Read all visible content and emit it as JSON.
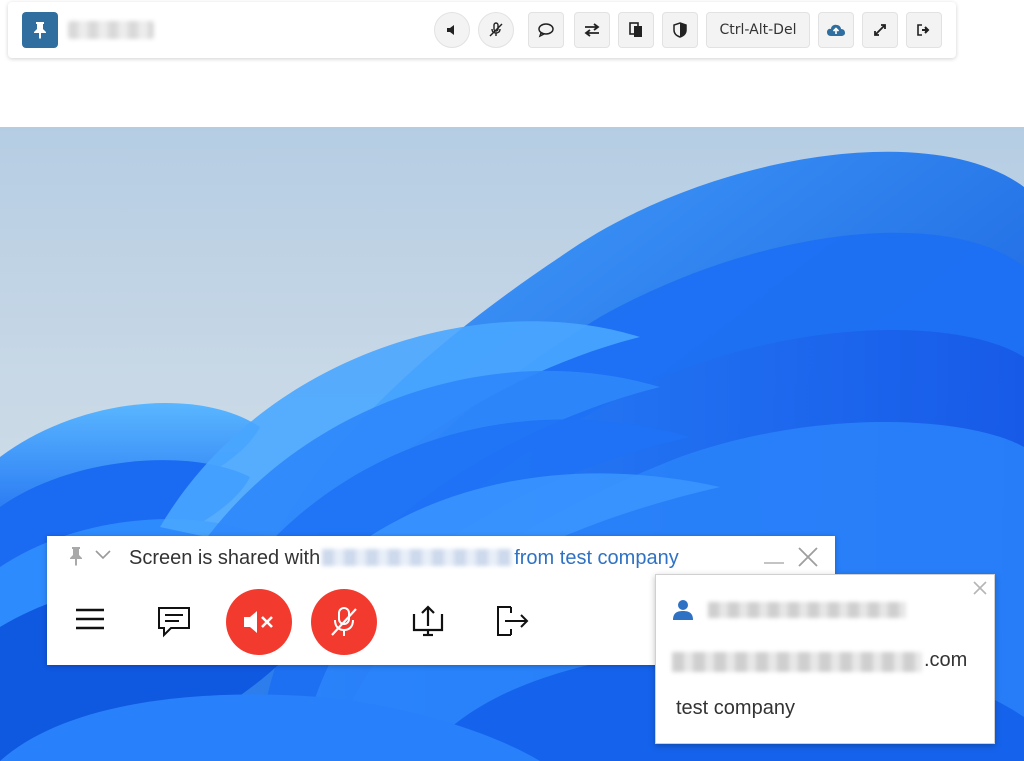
{
  "toolbar": {
    "ctrl_alt_del_label": "Ctrl-Alt-Del",
    "buttons": [
      "pin",
      "audio",
      "mic",
      "chat",
      "swap",
      "clipboard",
      "shield",
      "ctrl-alt-del",
      "upload",
      "fullscreen",
      "exit"
    ]
  },
  "sharebar": {
    "prefix": "Screen is shared with",
    "company": "from test company"
  },
  "popup": {
    "email_suffix": ".com",
    "company": "test company"
  },
  "colors": {
    "pin_button": "#2f6e9e",
    "red_action": "#f33a2f",
    "link_blue": "#2f72c4",
    "desktop_blue": "#1a6cf0"
  }
}
